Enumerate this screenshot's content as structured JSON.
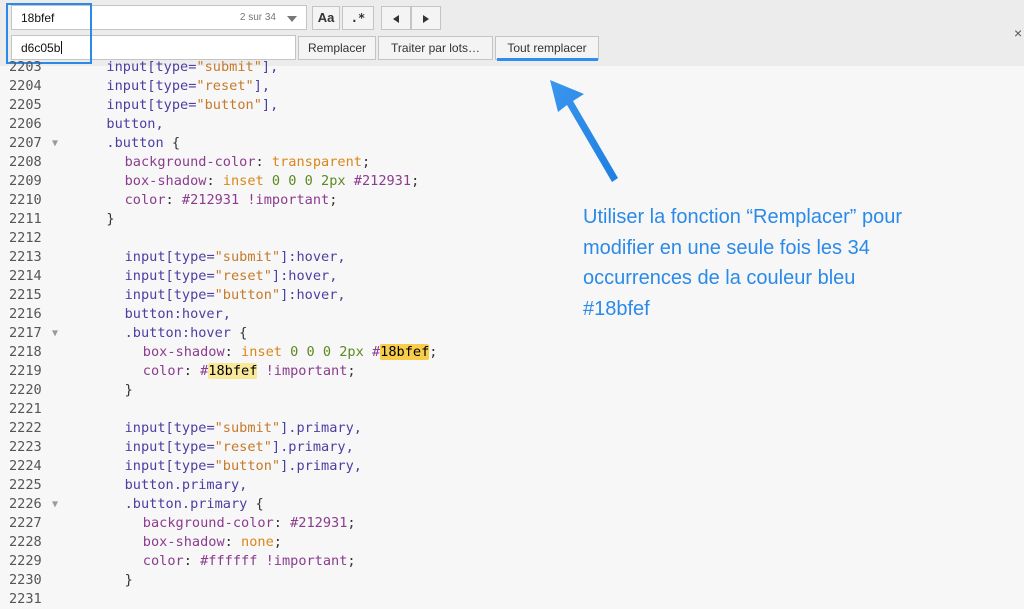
{
  "findbar": {
    "find_value": "18bfef",
    "match_count": "2 sur 34",
    "replace_value": "d6c05b",
    "case_label": "Aa",
    "regex_label": ".*",
    "replace_label": "Remplacer",
    "batch_label": "Traiter par lots…",
    "replace_all_label": "Tout remplacer",
    "close_label": "×"
  },
  "annotation": {
    "text": "Utiliser la fonction “Remplacer” pour modifier en une seule fois les 34 occurrences de la couleur bleu #18bfef",
    "color": "#2b8ae8"
  },
  "code": {
    "lines": [
      {
        "n": "2203",
        "fold": false,
        "indent": 8,
        "tokens": [
          [
            "sel",
            "input["
          ],
          [
            "sel",
            "type="
          ],
          [
            "str",
            "\"submit\""
          ],
          [
            "sel",
            "],"
          ]
        ]
      },
      {
        "n": "2204",
        "fold": false,
        "indent": 8,
        "tokens": [
          [
            "sel",
            "input["
          ],
          [
            "sel",
            "type="
          ],
          [
            "str",
            "\"reset\""
          ],
          [
            "sel",
            "],"
          ]
        ]
      },
      {
        "n": "2205",
        "fold": false,
        "indent": 8,
        "tokens": [
          [
            "sel",
            "input["
          ],
          [
            "sel",
            "type="
          ],
          [
            "str",
            "\"button\""
          ],
          [
            "sel",
            "],"
          ]
        ]
      },
      {
        "n": "2206",
        "fold": false,
        "indent": 8,
        "tokens": [
          [
            "sel",
            "button,"
          ]
        ]
      },
      {
        "n": "2207",
        "fold": true,
        "indent": 8,
        "tokens": [
          [
            "sel",
            ".button "
          ],
          [
            "punc",
            "{"
          ]
        ]
      },
      {
        "n": "2208",
        "fold": false,
        "indent": 12,
        "tokens": [
          [
            "prop",
            "background-color"
          ],
          [
            "punc",
            ": "
          ],
          [
            "kw",
            "transparent"
          ],
          [
            "punc",
            ";"
          ]
        ]
      },
      {
        "n": "2209",
        "fold": false,
        "indent": 12,
        "tokens": [
          [
            "prop",
            "box-shadow"
          ],
          [
            "punc",
            ": "
          ],
          [
            "kw",
            "inset "
          ],
          [
            "num",
            "0 0 0 2px "
          ],
          [
            "hex",
            "#212931"
          ],
          [
            "punc",
            ";"
          ]
        ]
      },
      {
        "n": "2210",
        "fold": false,
        "indent": 12,
        "tokens": [
          [
            "prop",
            "color"
          ],
          [
            "punc",
            ": "
          ],
          [
            "hex",
            "#212931 "
          ],
          [
            "imp",
            "!important"
          ],
          [
            "punc",
            ";"
          ]
        ]
      },
      {
        "n": "2211",
        "fold": false,
        "indent": 8,
        "tokens": [
          [
            "punc",
            "}"
          ]
        ]
      },
      {
        "n": "2212",
        "fold": false,
        "indent": 0,
        "tokens": []
      },
      {
        "n": "2213",
        "fold": false,
        "indent": 12,
        "tokens": [
          [
            "sel",
            "input["
          ],
          [
            "sel",
            "type="
          ],
          [
            "str",
            "\"submit\""
          ],
          [
            "sel",
            "]:hover,"
          ]
        ]
      },
      {
        "n": "2214",
        "fold": false,
        "indent": 12,
        "tokens": [
          [
            "sel",
            "input["
          ],
          [
            "sel",
            "type="
          ],
          [
            "str",
            "\"reset\""
          ],
          [
            "sel",
            "]:hover,"
          ]
        ]
      },
      {
        "n": "2215",
        "fold": false,
        "indent": 12,
        "tokens": [
          [
            "sel",
            "input["
          ],
          [
            "sel",
            "type="
          ],
          [
            "str",
            "\"button\""
          ],
          [
            "sel",
            "]:hover,"
          ]
        ]
      },
      {
        "n": "2216",
        "fold": false,
        "indent": 12,
        "tokens": [
          [
            "sel",
            "button:hover,"
          ]
        ]
      },
      {
        "n": "2217",
        "fold": true,
        "indent": 12,
        "tokens": [
          [
            "sel",
            ".button:hover "
          ],
          [
            "punc",
            "{"
          ]
        ]
      },
      {
        "n": "2218",
        "fold": false,
        "indent": 16,
        "tokens": [
          [
            "prop",
            "box-shadow"
          ],
          [
            "punc",
            ": "
          ],
          [
            "kw",
            "inset "
          ],
          [
            "num",
            "0 0 0 2px "
          ],
          [
            "hex",
            "#"
          ],
          [
            "hl",
            "18bfef"
          ],
          [
            "punc",
            ";"
          ]
        ]
      },
      {
        "n": "2219",
        "fold": false,
        "indent": 16,
        "tokens": [
          [
            "prop",
            "color"
          ],
          [
            "punc",
            ": "
          ],
          [
            "hex",
            "#"
          ],
          [
            "hl2",
            "18bfef"
          ],
          [
            "imp",
            " !important"
          ],
          [
            "punc",
            ";"
          ]
        ]
      },
      {
        "n": "2220",
        "fold": false,
        "indent": 12,
        "tokens": [
          [
            "punc",
            "}"
          ]
        ]
      },
      {
        "n": "2221",
        "fold": false,
        "indent": 0,
        "tokens": []
      },
      {
        "n": "2222",
        "fold": false,
        "indent": 12,
        "tokens": [
          [
            "sel",
            "input["
          ],
          [
            "sel",
            "type="
          ],
          [
            "str",
            "\"submit\""
          ],
          [
            "sel",
            "].primary,"
          ]
        ]
      },
      {
        "n": "2223",
        "fold": false,
        "indent": 12,
        "tokens": [
          [
            "sel",
            "input["
          ],
          [
            "sel",
            "type="
          ],
          [
            "str",
            "\"reset\""
          ],
          [
            "sel",
            "].primary,"
          ]
        ]
      },
      {
        "n": "2224",
        "fold": false,
        "indent": 12,
        "tokens": [
          [
            "sel",
            "input["
          ],
          [
            "sel",
            "type="
          ],
          [
            "str",
            "\"button\""
          ],
          [
            "sel",
            "].primary,"
          ]
        ]
      },
      {
        "n": "2225",
        "fold": false,
        "indent": 12,
        "tokens": [
          [
            "sel",
            "button.primary,"
          ]
        ]
      },
      {
        "n": "2226",
        "fold": true,
        "indent": 12,
        "tokens": [
          [
            "sel",
            ".button.primary "
          ],
          [
            "punc",
            "{"
          ]
        ]
      },
      {
        "n": "2227",
        "fold": false,
        "indent": 16,
        "tokens": [
          [
            "prop",
            "background-color"
          ],
          [
            "punc",
            ": "
          ],
          [
            "hex",
            "#212931"
          ],
          [
            "punc",
            ";"
          ]
        ]
      },
      {
        "n": "2228",
        "fold": false,
        "indent": 16,
        "tokens": [
          [
            "prop",
            "box-shadow"
          ],
          [
            "punc",
            ": "
          ],
          [
            "kw",
            "none"
          ],
          [
            "punc",
            ";"
          ]
        ]
      },
      {
        "n": "2229",
        "fold": false,
        "indent": 16,
        "tokens": [
          [
            "prop",
            "color"
          ],
          [
            "punc",
            ": "
          ],
          [
            "hex",
            "#ffffff "
          ],
          [
            "imp",
            "!important"
          ],
          [
            "punc",
            ";"
          ]
        ]
      },
      {
        "n": "2230",
        "fold": false,
        "indent": 12,
        "tokens": [
          [
            "punc",
            "}"
          ]
        ]
      },
      {
        "n": "2231",
        "fold": false,
        "indent": 0,
        "tokens": []
      }
    ]
  }
}
